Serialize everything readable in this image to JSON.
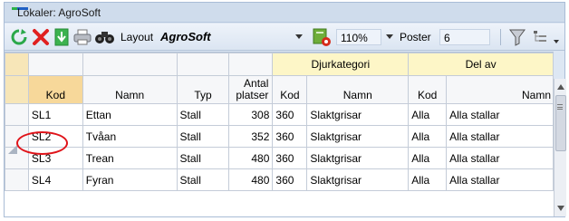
{
  "window": {
    "title": "Lokaler: AgroSoft"
  },
  "toolbar": {
    "layout_label": "Layout",
    "layout_value": "AgroSoft",
    "zoom": "110%",
    "poster_label": "Poster",
    "poster_value": "6",
    "icons": [
      "refresh-icon",
      "delete-icon",
      "download-icon",
      "print-icon",
      "binoculars-icon",
      "layout-settings-icon",
      "filter-icon",
      "tree-icon"
    ]
  },
  "grid": {
    "group_headers": {
      "djurkategori": "Djurkategori",
      "del_av": "Del av"
    },
    "columns": [
      "Kod",
      "Namn",
      "Typ",
      "Antal platser",
      "Kod",
      "Namn",
      "Kod",
      "Namn"
    ],
    "antal_line1": "Antal",
    "antal_line2": "platser",
    "rows": [
      {
        "kod": "SL1",
        "namn": "Ettan",
        "typ": "Stall",
        "antal": "308",
        "dk_kod": "360",
        "dk_namn": "Slaktgrisar",
        "del_kod": "Alla",
        "del_namn": "Alla stallar"
      },
      {
        "kod": "SL2",
        "namn": "Tvåan",
        "typ": "Stall",
        "antal": "352",
        "dk_kod": "360",
        "dk_namn": "Slaktgrisar",
        "del_kod": "Alla",
        "del_namn": "Alla stallar"
      },
      {
        "kod": "SL3",
        "namn": "Trean",
        "typ": "Stall",
        "antal": "480",
        "dk_kod": "360",
        "dk_namn": "Slaktgrisar",
        "del_kod": "Alla",
        "del_namn": "Alla stallar"
      },
      {
        "kod": "SL4",
        "namn": "Fyran",
        "typ": "Stall",
        "antal": "480",
        "dk_kod": "360",
        "dk_namn": "Slaktgrisar",
        "del_kod": "Alla",
        "del_namn": "Alla stallar"
      }
    ]
  },
  "colors": {
    "accent_red": "#e0141a",
    "header_yellow": "#fdf6c7",
    "sort_header": "#f7d89a"
  }
}
